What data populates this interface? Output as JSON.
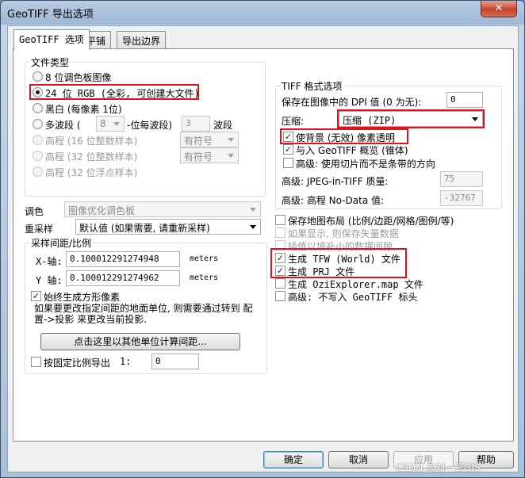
{
  "window": {
    "title": "GeoTIFF 导出选项",
    "close_glyph": "✕"
  },
  "tabs": [
    {
      "label": "GeoTIFF 选项"
    },
    {
      "label": "平铺"
    },
    {
      "label": "导出边界"
    }
  ],
  "file_type": {
    "title": "文件类型",
    "options": [
      {
        "label": "8 位调色板图像",
        "checked": false,
        "enabled": true
      },
      {
        "label": "24 位 RGB (全彩, 可创建大文件)",
        "checked": true,
        "enabled": true
      },
      {
        "label": "黑白 (每像素 1位)",
        "checked": false,
        "enabled": true
      },
      {
        "label": "多波段 (",
        "checked": false,
        "enabled": true
      },
      {
        "label": "高程 (16 位整数样本)",
        "checked": false,
        "enabled": false
      },
      {
        "label": "高程 (32 位整数样本)",
        "checked": false,
        "enabled": false
      },
      {
        "label": "高程 (32 位浮点样本)",
        "checked": false,
        "enabled": false
      }
    ],
    "multiband_bits": "8",
    "multiband_mid_label": "-位每波段)",
    "multiband_count": "3",
    "multiband_suffix": "波段",
    "sign_select_1": "有符号",
    "sign_select_2": "有符号"
  },
  "palette": {
    "label": "调色",
    "value": "图像优化调色板"
  },
  "resample": {
    "label": "重采样",
    "value": "默认值 (如果需要, 请重新采样)"
  },
  "sampling": {
    "title": "采样间距/比例",
    "x_label": "X-轴:",
    "x_value": "0.100012291274948",
    "x_unit": "meters",
    "y_label": "Y 轴:",
    "y_value": "0.100012291274962",
    "y_unit": "meters",
    "square_checkbox": "始终生成方形像素",
    "note": "如果要更改指定间距的地面单位, 则需要通过转到 配置->投影 来更改当前投影.",
    "calc_button": "点击这里以其他单位计算间距...",
    "fixed_scale_checkbox": "按固定比例导出",
    "fixed_scale_prefix": "1:",
    "fixed_scale_value": "0"
  },
  "tiff_options": {
    "title": "TIFF 格式选项",
    "dpi_label": "保存在图像中的 DPI 值 (0 为无):",
    "dpi_value": "0",
    "compression_label": "压缩:",
    "compression_value": "压缩 (ZIP)",
    "transparent_bg": "使背景 (无效) 像素透明",
    "geotiff_overview": "与入 GeoTIFF 概览 (锥体)",
    "advanced_tiles": "高级: 使用切片而不是条带的方向",
    "jpeg_quality_label": "高级: JPEG-in-TIFF 质量:",
    "jpeg_quality_value": "75",
    "nodata_label": "高级: 高程 No-Data 值:",
    "nodata_value": "-32767"
  },
  "extra_options": [
    {
      "label": "保存地图布局 (比例/边距/网格/图例/等)",
      "checked": false,
      "enabled": true,
      "mono": false
    },
    {
      "label": "如果显示, 则保存矢量数据",
      "checked": false,
      "enabled": false,
      "mono": false
    },
    {
      "label": "插值以填补小的数据间隙",
      "checked": false,
      "enabled": false,
      "mono": false
    },
    {
      "label": "生成 TFW (World) 文件",
      "checked": true,
      "enabled": true,
      "mono": true
    },
    {
      "label": "生成 PRJ 文件",
      "checked": true,
      "enabled": true,
      "mono": true
    },
    {
      "label": "生成 OziExplorer.map 文件",
      "checked": false,
      "enabled": true,
      "mono": true
    },
    {
      "label": "高级: 不写入 GeoTIFF 标头",
      "checked": false,
      "enabled": true,
      "mono": true
    }
  ],
  "buttons": {
    "ok": "确定",
    "cancel": "取消",
    "apply": "应用",
    "help": "帮助"
  },
  "watermark": "CSDN @刘一哥GIS",
  "highlight_color": "#e0121c"
}
